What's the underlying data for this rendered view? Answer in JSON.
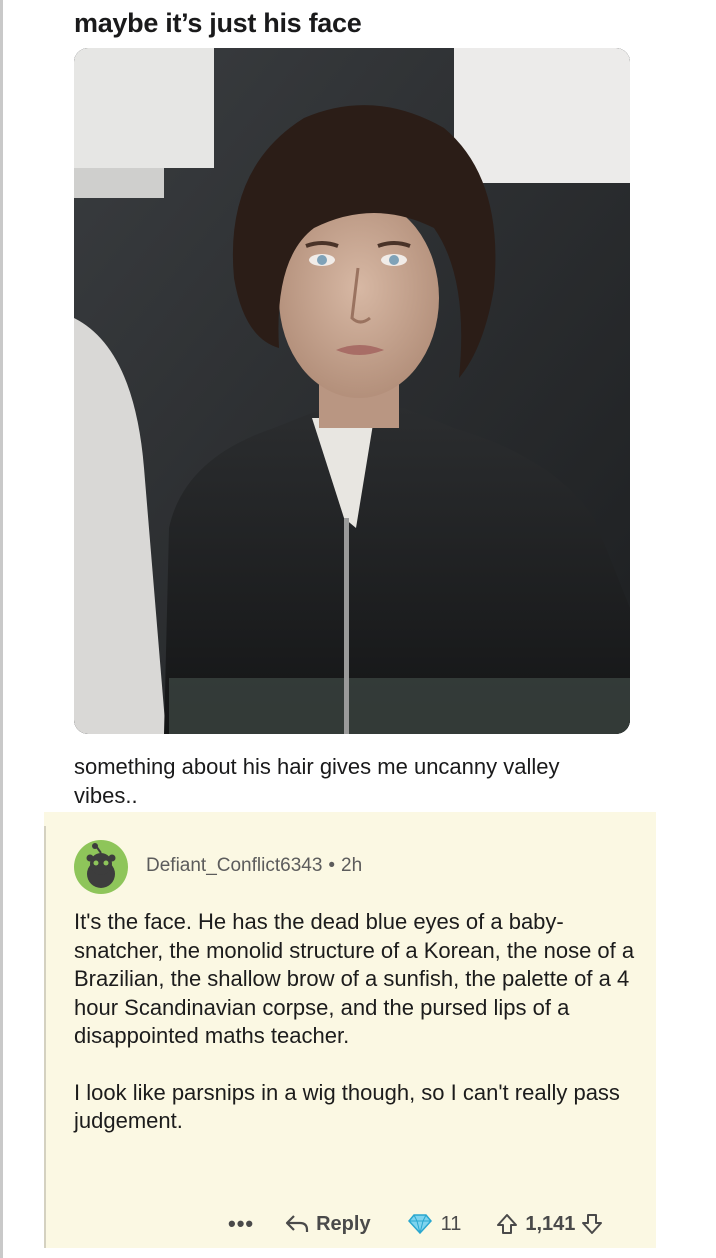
{
  "post": {
    "title": "maybe it’s just his face",
    "body": "something about his hair gives me uncanny valley vibes.."
  },
  "comment": {
    "username": "Defiant_Conflict6343",
    "separator": "•",
    "age": "2h",
    "paragraphs": [
      "It's the face. He has the dead blue eyes of a baby-snatcher, the monolid structure of a Korean, the nose of a Brazilian, the shallow brow of a sunfish, the palette of a 4 hour Scandinavian corpse, and the pursed lips of a disappointed maths teacher.",
      "I look like parsnips in a wig though, so I can't really pass judgement."
    ],
    "actions": {
      "more": "•••",
      "reply_label": "Reply",
      "award_count": "11",
      "vote_count": "1,141"
    }
  },
  "icons": {
    "avatar": "snoo-avatar-icon",
    "reply": "reply-arrow-icon",
    "award": "diamond-award-icon",
    "upvote": "upvote-arrow-icon",
    "downvote": "downvote-arrow-icon"
  },
  "colors": {
    "comment_background": "#fbf8e3",
    "avatar_background": "#8ec55a"
  }
}
